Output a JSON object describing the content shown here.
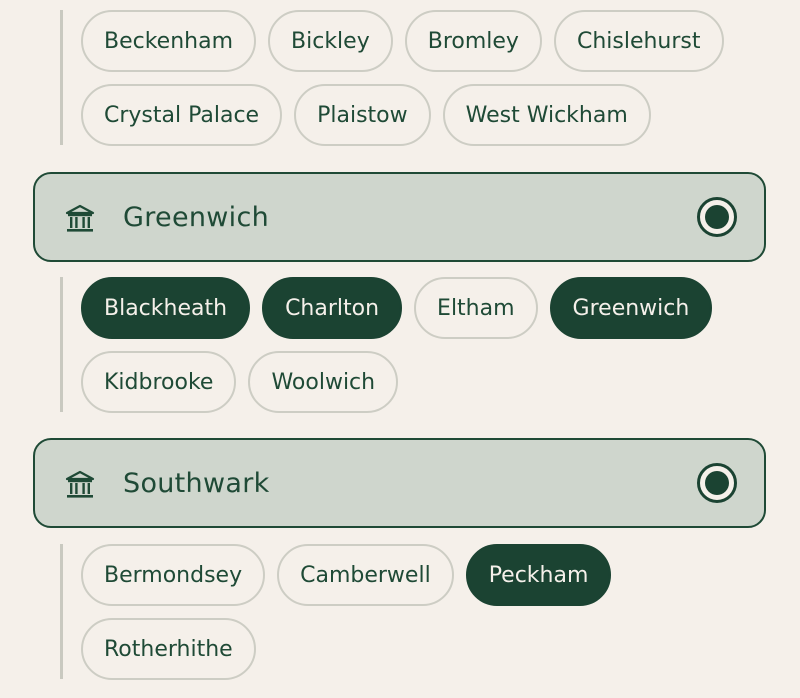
{
  "bromley": {
    "areas": [
      [
        "Beckenham",
        "Bickley",
        "Bromley",
        "Chislehurst"
      ],
      [
        "Crystal Palace",
        "Plaistow",
        "West Wickham"
      ]
    ]
  },
  "greenwich": {
    "title": "Greenwich",
    "icon": "bank-icon",
    "radio_selected": true,
    "areas": [
      [
        {
          "label": "Blackheath",
          "selected": true
        },
        {
          "label": "Charlton",
          "selected": true
        },
        {
          "label": "Eltham",
          "selected": false
        },
        {
          "label": "Greenwich",
          "selected": true
        }
      ],
      [
        {
          "label": "Kidbrooke",
          "selected": false
        },
        {
          "label": "Woolwich",
          "selected": false
        }
      ]
    ]
  },
  "southwark": {
    "title": "Southwark",
    "icon": "bank-icon",
    "radio_selected": true,
    "areas": [
      [
        {
          "label": "Bermondsey",
          "selected": false
        },
        {
          "label": "Camberwell",
          "selected": false
        },
        {
          "label": "Peckham",
          "selected": true
        }
      ],
      [
        {
          "label": "Rotherhithe",
          "selected": false
        }
      ]
    ]
  },
  "colors": {
    "background": "#f5f0ea",
    "accent": "#1b4332",
    "header_fill": "#cfd6cd",
    "chip_border": "#cdcdc4"
  }
}
